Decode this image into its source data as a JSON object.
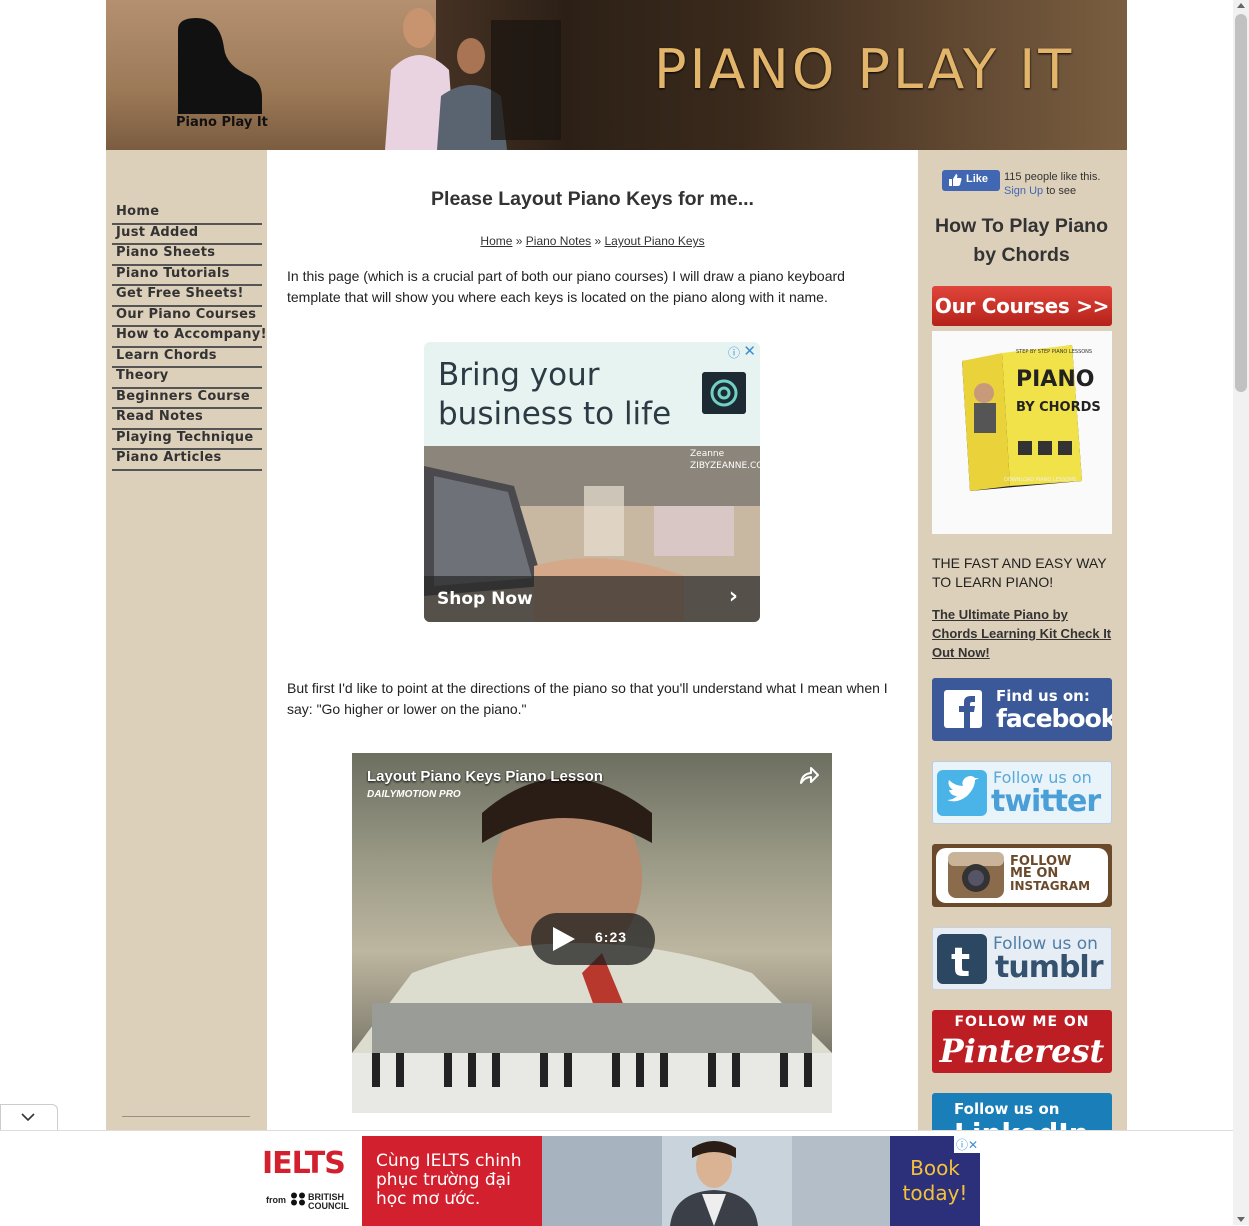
{
  "header": {
    "logo_text": "Piano Play It",
    "site_title": "PIANO PLAY IT"
  },
  "nav": {
    "items": [
      {
        "label": "Home"
      },
      {
        "label": "Just Added"
      },
      {
        "label": "Piano Sheets"
      },
      {
        "label": "Piano Tutorials"
      },
      {
        "label": "Get Free Sheets!"
      },
      {
        "label": "Our Piano Courses"
      },
      {
        "label": "How to Accompany!"
      },
      {
        "label": "Learn Chords"
      },
      {
        "label": "Theory"
      },
      {
        "label": "Beginners Course"
      },
      {
        "label": "Read Notes"
      },
      {
        "label": "Playing Technique"
      },
      {
        "label": "Piano Articles"
      }
    ]
  },
  "main": {
    "title": "Please Layout Piano Keys for me...",
    "breadcrumb": [
      {
        "label": "Home",
        "sep": " » "
      },
      {
        "label": "Piano Notes",
        "sep": " » "
      },
      {
        "label": "Layout Piano Keys",
        "sep": ""
      }
    ],
    "intro": "In this page (which is a crucial part of both our piano courses) I will draw a piano keyboard template that will show you where each keys is located on the piano along with it name.",
    "directions": "But first I'd like to point at the directions of the piano so that you'll understand what I mean when I say: \"Go higher or lower on the piano.\""
  },
  "content_ad": {
    "headline": "Bring your business to life",
    "brand_line1": "Zeanne",
    "brand_line2": "ZIBYZEANNE.CO",
    "cta": "Shop Now",
    "info_icon": "ⓘ",
    "close_icon": "✕"
  },
  "video": {
    "title": "Layout Piano Keys Piano Lesson",
    "provider": "DAILYMOTION PRO",
    "duration": "6:23"
  },
  "right": {
    "like_label": "Like",
    "like_count": "115 people like this.",
    "signup_link": "Sign Up",
    "signup_suffix": " to see",
    "heading": "How To Play Piano by Chords",
    "courses_button": "Our Courses >>",
    "product": {
      "line1": "PIANO",
      "line2": "BY CHORDS",
      "line3": "STEP BY STEP PIANO LESSONS",
      "line4": "DOWNLOAD PIANO LESSONS"
    },
    "tagline": "THE FAST AND EASY WAY TO LEARN PIANO!",
    "link": "The Ultimate Piano by Chords Learning Kit Check It Out Now!",
    "social": {
      "facebook_line1": "Find us on:",
      "facebook_line2": "facebook",
      "twitter_line1": "Follow us on",
      "twitter_line2": "twitter",
      "instagram_line1": "FOLLOW",
      "instagram_line2": "ME ON",
      "instagram_line3": "INSTAGRAM",
      "tumblr_line1": "Follow us on",
      "tumblr_line2": "tumblr",
      "pinterest_line1": "FOLLOW ME ON",
      "pinterest_line2": "Pinterest",
      "linkedin_line1": "Follow us on",
      "linkedin_line2": "LinkedIn"
    }
  },
  "bottom_ad": {
    "logo": "IELTS",
    "from": "from",
    "bc_line1": "BRITISH",
    "bc_line2": "COUNCIL",
    "message": "Cùng IELTS chinh phục trường đại học mơ ước.",
    "book": "Book today!",
    "adchoice": "ⓘ✕"
  },
  "colors": {
    "sidebar_bg": "#ddd0bb",
    "title_gold": "#e2b56a",
    "courses_red": "#d3382e",
    "ielts_red": "#d3202e"
  }
}
